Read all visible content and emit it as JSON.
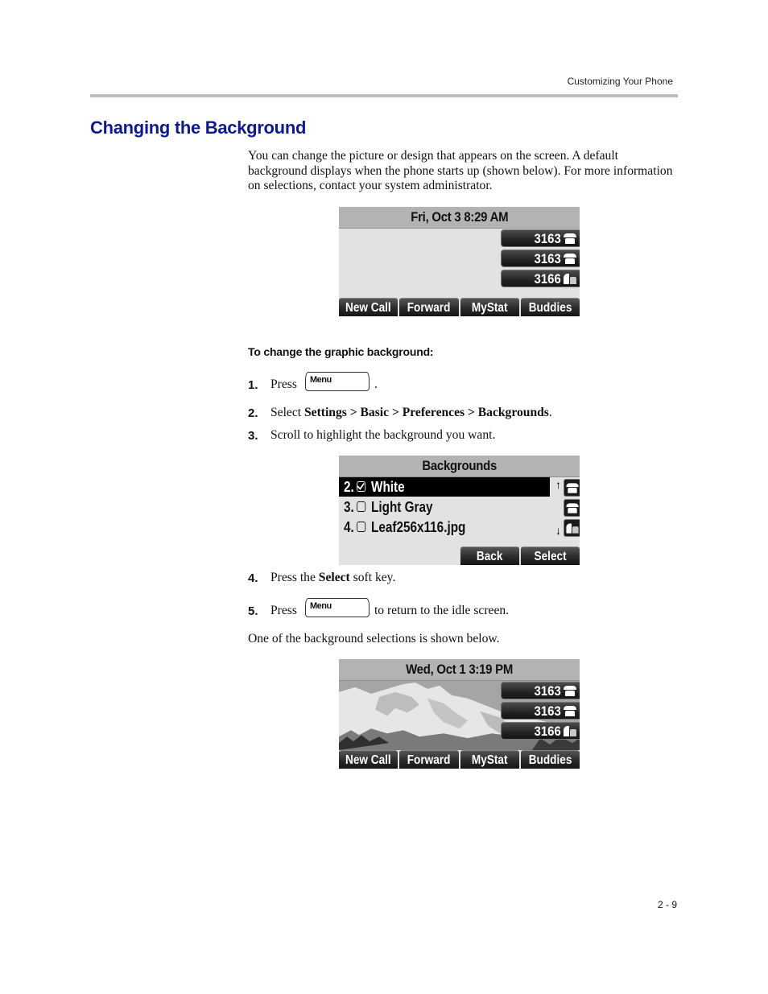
{
  "header": {
    "running_head": "Customizing Your Phone",
    "page_number": "2 - 9"
  },
  "section": {
    "title": "Changing the Background",
    "intro": "You can change the picture or design that appears on the screen. A default background displays when the phone starts up (shown below). For more information on selections, contact your system administrator."
  },
  "screen_default": {
    "datetime": "Fri, Oct 3   8:29 AM",
    "background": "default-light-gray",
    "line_keys": [
      {
        "label": "3163",
        "icon": "phone-onhook-icon"
      },
      {
        "label": "3163",
        "icon": "phone-onhook-icon"
      },
      {
        "label": "3166",
        "icon": "phone-offhook-icon"
      }
    ],
    "soft_keys": [
      "New Call",
      "Forward",
      "MyStat",
      "Buddies"
    ]
  },
  "procedure": {
    "heading": "To change the graphic background:",
    "menu_key_label": "Menu",
    "steps": [
      {
        "num": "1.",
        "pre": "Press",
        "post": "."
      },
      {
        "num": "2.",
        "pre": "Select ",
        "bold": "Settings > Basic > Preferences > Backgrounds",
        "post": "."
      },
      {
        "num": "3.",
        "text": "Scroll to highlight the background you want."
      },
      {
        "num": "4.",
        "pre": "Press the ",
        "bold": "Select",
        "post": " soft key."
      },
      {
        "num": "5.",
        "pre": "Press",
        "post": "to return to the idle screen."
      }
    ],
    "after_text": "One of the background selections is shown below."
  },
  "screen_backgrounds": {
    "title": "Backgrounds",
    "items": [
      {
        "index": "2.",
        "label": "White",
        "checked": true,
        "selected": true
      },
      {
        "index": "3.",
        "label": "Light Gray",
        "checked": false,
        "selected": false
      },
      {
        "index": "4.",
        "label": "Leaf256x116.jpg",
        "checked": false,
        "selected": false
      }
    ],
    "scroll_up": "↑",
    "scroll_down": "↓",
    "soft_keys": [
      "Back",
      "Select"
    ]
  },
  "screen_mountain": {
    "datetime": "Wed, Oct 1   3:19 PM",
    "background": "mountain-image",
    "line_keys": [
      {
        "label": "3163",
        "icon": "phone-onhook-icon"
      },
      {
        "label": "3163",
        "icon": "phone-onhook-icon"
      },
      {
        "label": "3166",
        "icon": "phone-offhook-icon"
      }
    ],
    "soft_keys": [
      "New Call",
      "Forward",
      "MyStat",
      "Buddies"
    ]
  }
}
